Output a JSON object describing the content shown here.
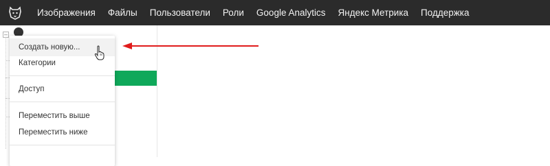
{
  "nav": {
    "logo_icon": "bear-logo-icon",
    "items": [
      {
        "label": "Изображения"
      },
      {
        "label": "Файлы"
      },
      {
        "label": "Пользователи"
      },
      {
        "label": "Роли"
      },
      {
        "label": "Google Analytics"
      },
      {
        "label": "Яндекс Метрика"
      },
      {
        "label": "Поддержка"
      }
    ]
  },
  "context_menu": {
    "items": [
      {
        "label": "Создать новую..."
      },
      {
        "label": "Категории"
      },
      {
        "label": "Доступ"
      },
      {
        "label": "Переместить выше"
      },
      {
        "label": "Переместить ниже"
      }
    ]
  },
  "colors": {
    "topbar": "#2b2b2b",
    "accent_green": "#0fa85a",
    "annotation_arrow": "#e01b1b"
  }
}
